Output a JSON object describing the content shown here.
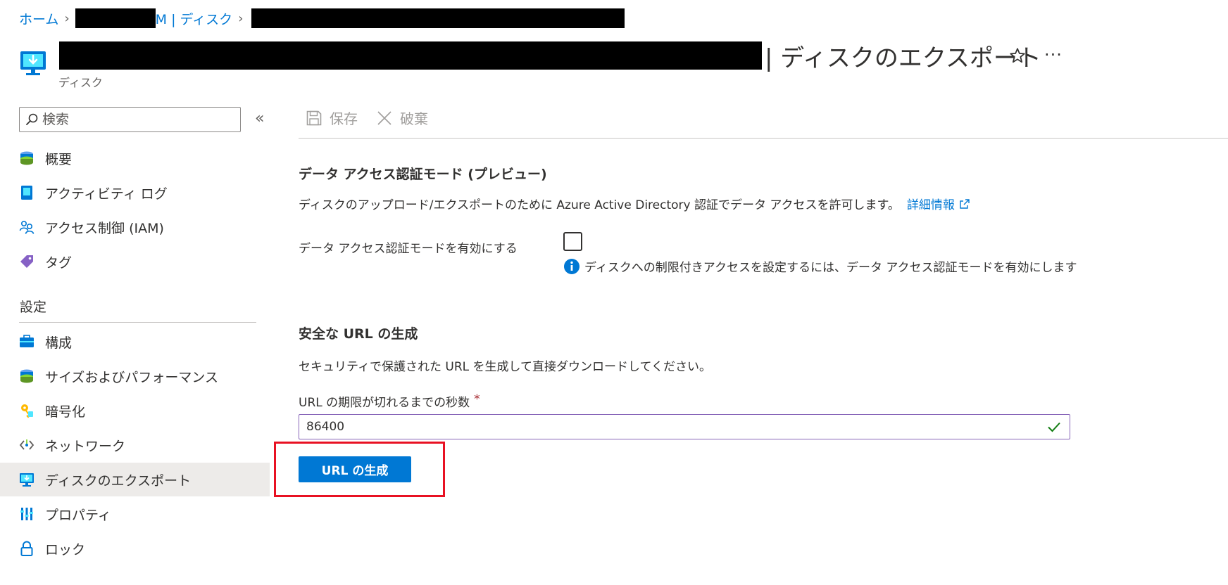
{
  "breadcrumb": {
    "home": "ホーム",
    "resource_tail": "M | ディスク"
  },
  "header": {
    "title_suffix": "| ディスクのエクスポート",
    "subtitle": "ディスク",
    "icons": {
      "resource": "disk-export-icon",
      "favorite": "star-icon",
      "more": "more-icon"
    }
  },
  "sidebar": {
    "search_placeholder": "検索",
    "collapse_glyph": "«",
    "items_top": [
      {
        "label": "概要",
        "icon": "overview-icon"
      },
      {
        "label": "アクティビティ ログ",
        "icon": "activity-log-icon"
      },
      {
        "label": "アクセス制御 (IAM)",
        "icon": "iam-icon"
      },
      {
        "label": "タグ",
        "icon": "tag-icon"
      }
    ],
    "section_label": "設定",
    "items_settings": [
      {
        "label": "構成",
        "icon": "configuration-icon"
      },
      {
        "label": "サイズおよびパフォーマンス",
        "icon": "size-performance-icon"
      },
      {
        "label": "暗号化",
        "icon": "encryption-icon"
      },
      {
        "label": "ネットワーク",
        "icon": "networking-icon"
      },
      {
        "label": "ディスクのエクスポート",
        "icon": "disk-export-icon",
        "selected": true
      },
      {
        "label": "プロパティ",
        "icon": "properties-icon"
      },
      {
        "label": "ロック",
        "icon": "lock-icon"
      }
    ]
  },
  "toolbar": {
    "save_label": "保存",
    "discard_label": "破棄"
  },
  "data_access": {
    "heading": "データ アクセス認証モード (プレビュー)",
    "description": "ディスクのアップロード/エクスポートのために Azure Active Directory 認証でデータ アクセスを許可します。",
    "learn_more": "詳細情報",
    "toggle_label": "データ アクセス認証モードを有効にする",
    "checked": false,
    "info_text": "ディスクへの制限付きアクセスを設定するには、データ アクセス認証モードを有効にします"
  },
  "secure_url": {
    "heading": "安全な URL の生成",
    "description": "セキュリティで保護された URL を生成して直接ダウンロードしてください。",
    "field_label": "URL の期限が切れるまでの秒数",
    "required_marker": "*",
    "field_value": "86400",
    "generate_button": "URL の生成"
  },
  "colors": {
    "accent": "#0078d4",
    "selected_bg": "#edebe9",
    "input_border": "#8764b8",
    "valid": "#107c10",
    "highlight": "#e81123"
  }
}
